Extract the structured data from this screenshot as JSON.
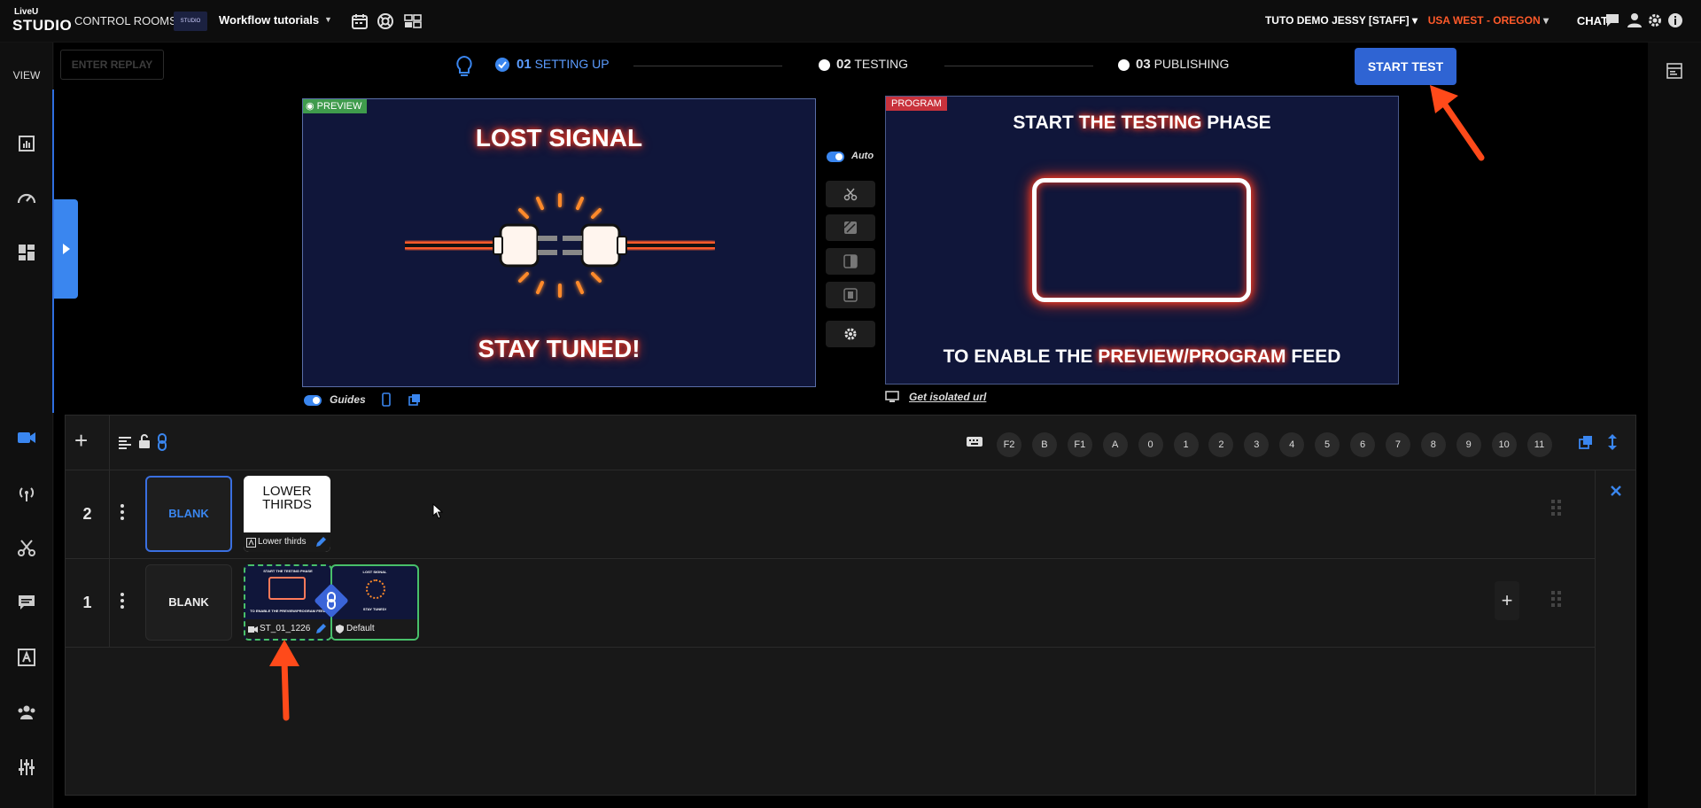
{
  "topbar": {
    "logo_top": "LiveU",
    "logo_main": "STUDIO",
    "control_rooms": "CONTROL ROOMS",
    "room_thumb": "STUDIO",
    "room_name": "Workflow tutorials",
    "user": "TUTO DEMO JESSY [STAFF]",
    "region": "USA WEST - OREGON",
    "chat": "CHAT"
  },
  "sidebar": {
    "view_label": "VIEW",
    "icons": [
      "stats-icon",
      "gauge-icon",
      "layout-icon",
      "camera-icon",
      "broadcast-icon",
      "scissors-icon",
      "comment-icon",
      "text-icon",
      "users-icon",
      "sliders-icon"
    ]
  },
  "toolbar": {
    "enter_replay": "ENTER REPLAY",
    "start_test": "START TEST"
  },
  "steps": [
    {
      "num": "01",
      "label": "SETTING UP",
      "state": "done"
    },
    {
      "num": "02",
      "label": "TESTING",
      "state": "pending"
    },
    {
      "num": "03",
      "label": "PUBLISHING",
      "state": "pending"
    }
  ],
  "preview": {
    "badge": "PREVIEW",
    "top_text": "LOST SIGNAL",
    "bottom_text": "STAY TUNED!",
    "guides_label": "Guides"
  },
  "program": {
    "badge": "PROGRAM",
    "line1_a": "START ",
    "line1_hl": "THE TESTING",
    "line1_b": " PHASE",
    "line2_a": "TO ENABLE THE ",
    "line2_hl": "PREVIEW/PROGRAM",
    "line2_b": " FEED",
    "isolated_url": "Get isolated url"
  },
  "transitions": {
    "auto_label": "Auto"
  },
  "hotkeys": [
    "F2",
    "B",
    "F1",
    "A",
    "0",
    "1",
    "2",
    "3",
    "4",
    "5",
    "6",
    "7",
    "8",
    "9",
    "10",
    "11"
  ],
  "layers": [
    {
      "num": "2",
      "blank_label": "BLANK",
      "card": {
        "title_line1": "LOWER",
        "title_line2": "THIRDS",
        "foot": "Lower thirds"
      }
    },
    {
      "num": "1",
      "blank_label": "BLANK",
      "card_a": {
        "foot": "ST_01_1226",
        "mini1": "START THE TESTING PHASE",
        "mini2": "TO ENABLE THE PREVIEW/PROGRAM FEED"
      },
      "card_b": {
        "foot": "Default",
        "mini1": "LOST SIGNAL",
        "mini2": "STAY TUNED!"
      }
    }
  ],
  "colors": {
    "accent": "#2f64d3",
    "arrow": "#ff4a1a",
    "neon": "#ff3b1f",
    "preview_green": "#3f9b4c",
    "program_red": "#c8323c"
  }
}
